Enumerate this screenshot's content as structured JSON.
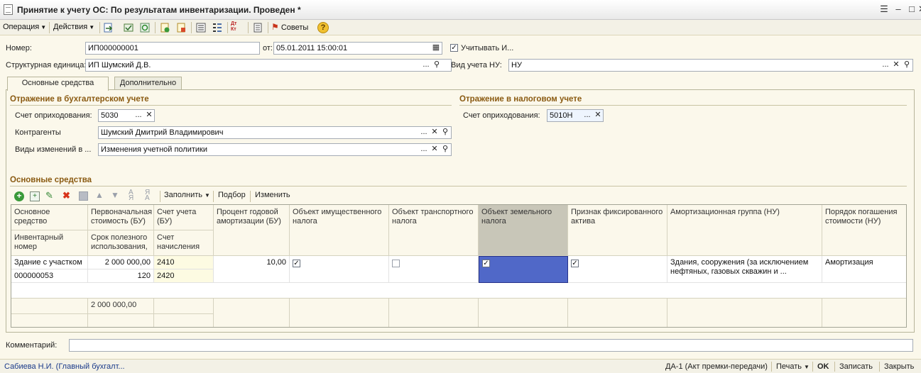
{
  "window": {
    "title": "Принятие к учету ОС: По результатам инвентаризации. Проведен *"
  },
  "toolbar": {
    "operation_label": "Операция",
    "actions_label": "Действия",
    "dtkt_label": "Дт Кт",
    "sovety_label": "Советы"
  },
  "header": {
    "number_label": "Номер:",
    "number_value": "ИП000000001",
    "date_label": "от:",
    "date_value": "05.01.2011 15:00:01",
    "consider_label": "Учитывать И...",
    "consider_checked": true,
    "unit_label": "Структурная единица:",
    "unit_value": "ИП Шумский Д.В.",
    "nu_type_label": "Вид учета НУ:",
    "nu_type_value": "НУ"
  },
  "tabs": [
    {
      "label": "Основные средства",
      "active": true
    },
    {
      "label": "Дополнительно",
      "active": false
    }
  ],
  "accounting": {
    "title": "Отражение в бухгалтерском учете",
    "account_label": "Счет оприходования:",
    "account_value": "5030",
    "contractors_label": "Контрагенты",
    "contractors_value": "Шумский Дмитрий Владимирович",
    "changes_label": "Виды изменений в ...",
    "changes_value": "Изменения учетной политики"
  },
  "tax": {
    "title": "Отражение в налоговом учете",
    "account_label": "Счет оприходования:",
    "account_value": "5010Н"
  },
  "assets": {
    "title": "Основные средства",
    "fill_label": "Заполнить",
    "select_label": "Подбор",
    "change_label": "Изменить",
    "columns": {
      "asset": "Основное средство",
      "inventory": "Инвентарный номер",
      "initial_cost": "Первоначальная стоимость (БУ)",
      "useful_life": "Срок полезного использования,",
      "account": "Счет учета (БУ)",
      "charge_account": "Счет начисления",
      "depr_percent": "Процент годовой амортизации (БУ)",
      "property_tax": "Объект имущественного налога",
      "transport_tax": "Объект транспортного налога",
      "land_tax": "Объект земельного налога",
      "fixed_asset": "Признак фиксированного актива",
      "depr_group": "Амортизационная группа (НУ)",
      "repayment": "Порядок погашения стоимости (НУ)"
    },
    "row": {
      "asset": "Здание с участком",
      "inventory": "000000053",
      "initial_cost": "2 000 000,00",
      "useful_life": "120",
      "account": "2410",
      "charge_account": "2420",
      "depr_percent": "10,00",
      "property_tax": true,
      "transport_tax": false,
      "land_tax": true,
      "fixed_asset": true,
      "depr_group": "Здания, сооружения (за исключением нефтяных, газовых скважин и ...",
      "repayment": "Амортизация"
    },
    "total_cost": "2 000 000,00"
  },
  "comment": {
    "label": "Комментарий:",
    "value": ""
  },
  "status": {
    "user": "Сабиева Н.И. (Главный бухгалт...",
    "print_form": "ДА-1 (Акт премки-передачи)",
    "print_label": "Печать",
    "ok_label": "OK",
    "save_label": "Записать",
    "close_label": "Закрыть"
  },
  "colors": {
    "section": "#8a5a11",
    "selected_cell": "#5068c8",
    "selected_header": "#c8c6b8"
  }
}
